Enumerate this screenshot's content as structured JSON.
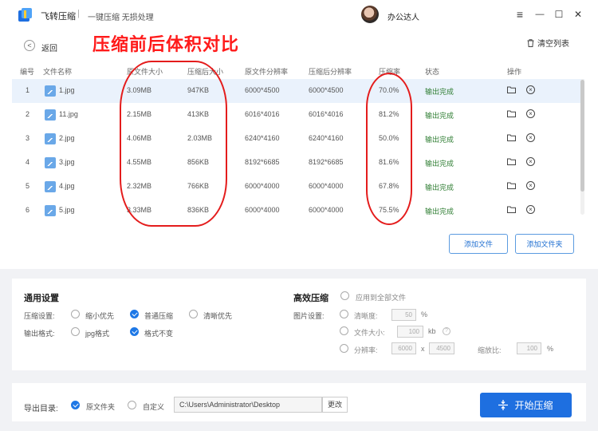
{
  "app": {
    "title": "飞转压缩",
    "separator": "|",
    "subtitle": "一键压缩 无损处理",
    "user_name": "办公达人"
  },
  "window_controls": {
    "menu": "≡",
    "minimize": "—",
    "maximize": "☐",
    "close": "✕"
  },
  "main": {
    "back_label": "返回",
    "annotation_title": "压缩前后体积对比",
    "clear_list": "清空列表"
  },
  "table": {
    "headers": [
      "编号",
      "文件名称",
      "原文件大小",
      "压缩后大小",
      "原文件分辨率",
      "压缩后分辨率",
      "压缩率",
      "状态",
      "操作"
    ],
    "rows": [
      {
        "no": "1",
        "name": "1.jpg",
        "orig_size": "3.09MB",
        "new_size": "947KB",
        "orig_res": "6000*4500",
        "new_res": "6000*4500",
        "rate": "70.0%",
        "status": "输出完成"
      },
      {
        "no": "2",
        "name": "11.jpg",
        "orig_size": "2.15MB",
        "new_size": "413KB",
        "orig_res": "6016*4016",
        "new_res": "6016*4016",
        "rate": "81.2%",
        "status": "输出完成"
      },
      {
        "no": "3",
        "name": "2.jpg",
        "orig_size": "4.06MB",
        "new_size": "2.03MB",
        "orig_res": "6240*4160",
        "new_res": "6240*4160",
        "rate": "50.0%",
        "status": "输出完成"
      },
      {
        "no": "4",
        "name": "3.jpg",
        "orig_size": "4.55MB",
        "new_size": "856KB",
        "orig_res": "8192*6685",
        "new_res": "8192*6685",
        "rate": "81.6%",
        "status": "输出完成"
      },
      {
        "no": "5",
        "name": "4.jpg",
        "orig_size": "2.32MB",
        "new_size": "766KB",
        "orig_res": "6000*4000",
        "new_res": "6000*4000",
        "rate": "67.8%",
        "status": "输出完成"
      },
      {
        "no": "6",
        "name": "5.jpg",
        "orig_size": "3.33MB",
        "new_size": "836KB",
        "orig_res": "6000*4000",
        "new_res": "6000*4000",
        "rate": "75.5%",
        "status": "输出完成"
      }
    ]
  },
  "buttons": {
    "add_file": "添加文件",
    "add_folder": "添加文件夹",
    "start": "开始压缩",
    "change": "更改"
  },
  "general": {
    "title": "通用设置",
    "compress_label": "压缩设置:",
    "compress_options": [
      "缩小优先",
      "普通压缩",
      "清晰优先"
    ],
    "compress_selected": "普通压缩",
    "format_label": "输出格式:",
    "format_options": [
      "jpg格式",
      "格式不变"
    ],
    "format_selected": "格式不变"
  },
  "advanced": {
    "title": "高效压缩",
    "apply_all": "应用到全部文件",
    "image_label": "图片设置:",
    "clarity_label": "清晰度:",
    "clarity_value": "50",
    "clarity_unit": "%",
    "size_label": "文件大小:",
    "size_value": "100",
    "size_unit": "kb",
    "help": "?",
    "res_label": "分辨率:",
    "res_w": "6000",
    "res_x": "x",
    "res_h": "4500",
    "scale_label": "缩放比:",
    "scale_value": "100",
    "scale_unit": "%"
  },
  "output": {
    "label": "导出目录:",
    "options": [
      "原文件夹",
      "自定义"
    ],
    "selected": "原文件夹",
    "path": "C:\\Users\\Administrator\\Desktop"
  },
  "colors": {
    "accent": "#1e6fe0",
    "annotation": "#ff1b1b",
    "status": "#2e7d32",
    "row_highlight": "#eaf2fc"
  }
}
